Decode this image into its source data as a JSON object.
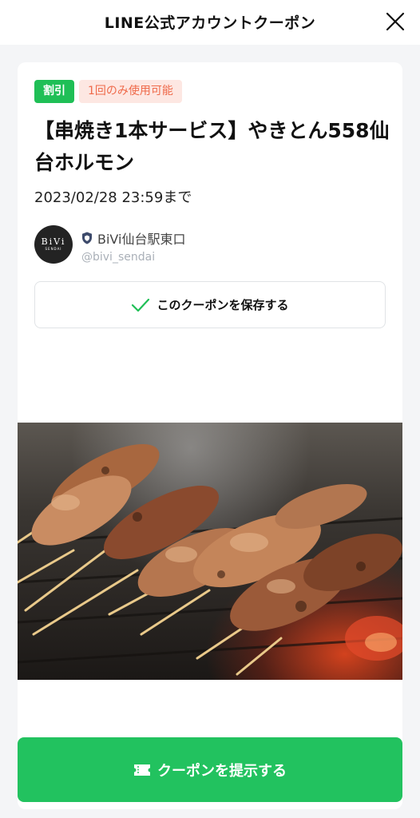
{
  "header": {
    "title": "LINE公式アカウントクーポン"
  },
  "coupon": {
    "badge_type": "割引",
    "badge_limit": "1回のみ使用可能",
    "title": "【串焼き1本サービス】やきとん558仙台ホルモン",
    "expiry": "2023/02/28 23:59まで",
    "save_label": "このクーポンを保存する",
    "present_label": "クーポンを提示する",
    "photo_icon": "grilled-skewers-photo"
  },
  "account": {
    "logo_text": "BiVi",
    "logo_subtext": "SENDAI",
    "name": "BiVi仙台駅東口",
    "id": "@bivi_sendai",
    "verified_icon": "shield-icon"
  },
  "colors": {
    "accent_green": "#22c25f",
    "badge_green": "#1fbf56",
    "badge_orange_text": "#ef6a4a",
    "badge_orange_bg": "#fde7e2",
    "check_green": "#1fbf56"
  }
}
